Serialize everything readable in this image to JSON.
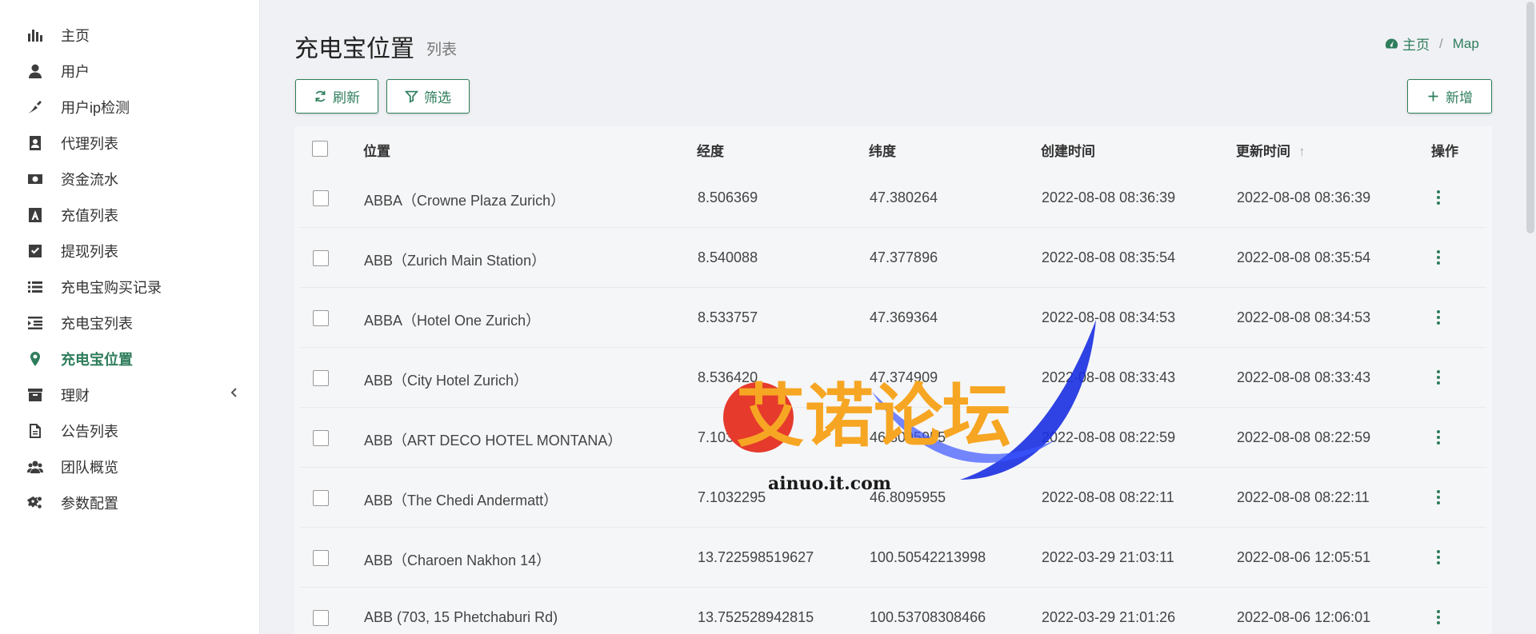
{
  "sidebar": {
    "items": [
      {
        "label": "主页",
        "icon": "bar-chart-icon"
      },
      {
        "label": "用户",
        "icon": "user-icon"
      },
      {
        "label": "用户ip检测",
        "icon": "tool-icon"
      },
      {
        "label": "代理列表",
        "icon": "contact-card-icon"
      },
      {
        "label": "资金流水",
        "icon": "money-icon"
      },
      {
        "label": "充值列表",
        "icon": "letter-a-icon"
      },
      {
        "label": "提现列表",
        "icon": "check-square-icon"
      },
      {
        "label": "充电宝购买记录",
        "icon": "list-icon"
      },
      {
        "label": "充电宝列表",
        "icon": "indent-icon"
      },
      {
        "label": "充电宝位置",
        "icon": "map-pin-icon",
        "active": true
      },
      {
        "label": "理财",
        "icon": "archive-icon",
        "has_children": true
      },
      {
        "label": "公告列表",
        "icon": "document-icon"
      },
      {
        "label": "团队概览",
        "icon": "users-icon"
      },
      {
        "label": "参数配置",
        "icon": "gears-icon"
      }
    ]
  },
  "header": {
    "title": "充电宝位置",
    "subtitle": "列表",
    "breadcrumb": {
      "home": "主页",
      "separator": "/",
      "current": "Map"
    }
  },
  "toolbar": {
    "refresh_label": "刷新",
    "filter_label": "筛选",
    "add_label": "新增"
  },
  "table": {
    "columns": [
      "位置",
      "经度",
      "纬度",
      "创建时间",
      "更新时间",
      "操作"
    ],
    "sort_indicator": "↑",
    "rows": [
      {
        "location": "ABBA（Crowne Plaza Zurich）",
        "lng": "8.506369",
        "lat": "47.380264",
        "created": "2022-08-08 08:36:39",
        "updated": "2022-08-08 08:36:39"
      },
      {
        "location": "ABB（Zurich Main Station）",
        "lng": "8.540088",
        "lat": "47.377896",
        "created": "2022-08-08 08:35:54",
        "updated": "2022-08-08 08:35:54"
      },
      {
        "location": "ABBA（Hotel One Zurich）",
        "lng": "8.533757",
        "lat": "47.369364",
        "created": "2022-08-08 08:34:53",
        "updated": "2022-08-08 08:34:53"
      },
      {
        "location": "ABB（City Hotel Zurich）",
        "lng": "8.536420",
        "lat": "47.374909",
        "created": "2022-08-08 08:33:43",
        "updated": "2022-08-08 08:33:43"
      },
      {
        "location": "ABB（ART DECO HOTEL MONTANA）",
        "lng": "7.1032295",
        "lat": "46.8095955",
        "created": "2022-08-08 08:22:59",
        "updated": "2022-08-08 08:22:59"
      },
      {
        "location": "ABB（The Chedi Andermatt）",
        "lng": "7.1032295",
        "lat": "46.8095955",
        "created": "2022-08-08 08:22:11",
        "updated": "2022-08-08 08:22:11"
      },
      {
        "location": "ABB（Charoen Nakhon 14）",
        "lng": "13.722598519627",
        "lat": "100.50542213998",
        "created": "2022-03-29 21:03:11",
        "updated": "2022-08-06 12:05:51"
      },
      {
        "location": "ABB (703, 15 Phetchaburi Rd)",
        "lng": "13.752528942815",
        "lat": "100.53708308466",
        "created": "2022-03-29 21:01:26",
        "updated": "2022-08-06 12:06:01"
      }
    ]
  },
  "watermark": {
    "text": "艾诺论坛",
    "domain": "ainuo.it.com"
  },
  "colors": {
    "accent": "#2e7d5b",
    "watermark_text": "#f6a623",
    "watermark_swoosh": "#1a2fe0"
  }
}
